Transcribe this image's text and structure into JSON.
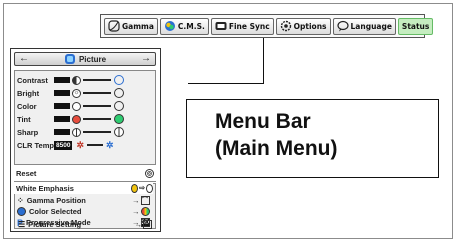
{
  "menu_bar": {
    "tabs": [
      {
        "label": "Gamma",
        "icon": "gamma-icon"
      },
      {
        "label": "C.M.S.",
        "icon": "cms-icon"
      },
      {
        "label": "Fine Sync",
        "icon": "fine-sync-icon"
      },
      {
        "label": "Options",
        "icon": "options-icon"
      },
      {
        "label": "Language",
        "icon": "language-icon"
      },
      {
        "label": "Status",
        "icon": ""
      }
    ]
  },
  "callout": {
    "line1": "Menu Bar",
    "line2": "(Main Menu)"
  },
  "panel": {
    "title": "Picture",
    "left_arrow": "←",
    "right_arrow": "→",
    "adjustments": [
      {
        "label": "Contrast",
        "icon": "contrast-icon"
      },
      {
        "label": "Bright",
        "icon": "bright-icon"
      },
      {
        "label": "Color",
        "icon": "color-icon"
      },
      {
        "label": "Tint",
        "icon": "tint-icon"
      },
      {
        "label": "Sharp",
        "icon": "sharp-icon"
      }
    ],
    "clr_temp": {
      "label": "CLR Temp",
      "value": "8500"
    },
    "reset": {
      "label": "Reset"
    },
    "white_emphasis": {
      "label": "White Emphasis"
    },
    "submenu": [
      {
        "label": "Gamma Position"
      },
      {
        "label": "Color Selected"
      },
      {
        "label": "Progressive Mode",
        "badge": "3D"
      },
      {
        "label": "Picture Setting",
        "badge": "IN"
      }
    ]
  }
}
